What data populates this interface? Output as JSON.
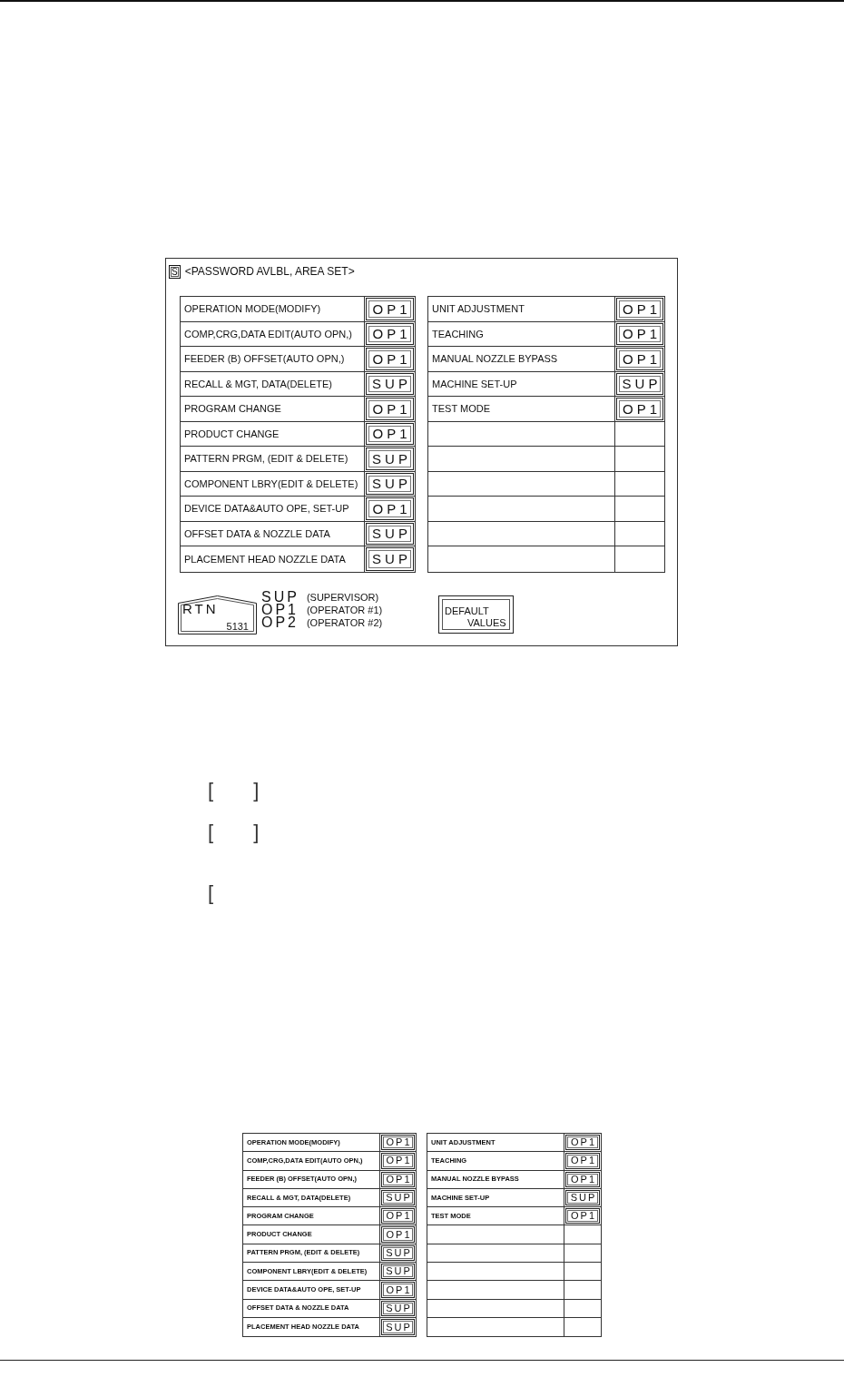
{
  "screen": {
    "tag": "S",
    "title": "<PASSWORD AVLBL, AREA SET>",
    "left_rows": [
      {
        "kind": "entry",
        "label": "OPERATION MODE(MODIFY)",
        "access": "OP1"
      },
      {
        "kind": "entry",
        "label": "COMP,CRG,DATA EDIT(AUTO OPN,)",
        "access": "OP1"
      },
      {
        "kind": "entry",
        "label": "FEEDER (B) OFFSET(AUTO OPN,)",
        "access": "OP1"
      },
      {
        "kind": "entry",
        "label": "RECALL & MGT, DATA(DELETE)",
        "access": "SUP"
      },
      {
        "kind": "entry",
        "label": "PROGRAM CHANGE",
        "access": "OP1"
      },
      {
        "kind": "entry",
        "label": "PRODUCT CHANGE",
        "access": "OP1"
      },
      {
        "kind": "entry",
        "label": "PATTERN PRGM, (EDIT & DELETE)",
        "access": "SUP"
      },
      {
        "kind": "entry",
        "label": "COMPONENT LBRY(EDIT & DELETE)",
        "access": "SUP"
      },
      {
        "kind": "entry",
        "label": "DEVICE DATA&AUTO OPE, SET-UP",
        "access": "OP1"
      },
      {
        "kind": "entry",
        "label": "OFFSET DATA & NOZZLE DATA",
        "access": "SUP"
      },
      {
        "kind": "entry",
        "label": "PLACEMENT HEAD NOZZLE DATA",
        "access": "SUP"
      }
    ],
    "right_rows": [
      {
        "kind": "entry",
        "label": "UNIT ADJUSTMENT",
        "access": "OP1"
      },
      {
        "kind": "entry",
        "label": "TEACHING",
        "access": "OP1"
      },
      {
        "kind": "entry",
        "label": "MANUAL NOZZLE BYPASS",
        "access": "OP1"
      },
      {
        "kind": "entry",
        "label": "MACHINE SET-UP",
        "access": "SUP"
      },
      {
        "kind": "entry",
        "label": "TEST MODE",
        "access": "OP1"
      },
      {
        "kind": "blank"
      },
      {
        "kind": "blank"
      },
      {
        "kind": "blank"
      },
      {
        "kind": "blank"
      },
      {
        "kind": "blank"
      },
      {
        "kind": "blank"
      }
    ],
    "return_button": {
      "label": "RTN",
      "code": "5131"
    },
    "legend": [
      {
        "code": "SUP",
        "meaning": "(SUPERVISOR)"
      },
      {
        "code": "OP1",
        "meaning": "(OPERATOR #1)"
      },
      {
        "code": "OP2",
        "meaning": "(OPERATOR #2)"
      }
    ],
    "default_button": {
      "lines": [
        "DEFAULT",
        "VALUES"
      ]
    }
  },
  "blanks": [
    {
      "open": "[",
      "close": "]"
    },
    {
      "open": "[",
      "close": "]"
    },
    {
      "open": "["
    }
  ],
  "figure_table": {
    "left_rows": [
      {
        "kind": "entry",
        "label": "OPERATION MODE(MODIFY)",
        "access": "OP1"
      },
      {
        "kind": "entry",
        "label": "COMP,CRG,DATA EDIT(AUTO OPN,)",
        "access": "OP1"
      },
      {
        "kind": "entry",
        "label": "FEEDER (B) OFFSET(AUTO OPN,)",
        "access": "OP1"
      },
      {
        "kind": "entry",
        "label": "RECALL & MGT, DATA(DELETE)",
        "access": "SUP"
      },
      {
        "kind": "entry",
        "label": "PROGRAM CHANGE",
        "access": "OP1"
      },
      {
        "kind": "entry",
        "label": "PRODUCT CHANGE",
        "access": "OP1"
      },
      {
        "kind": "entry",
        "label": "PATTERN PRGM, (EDIT & DELETE)",
        "access": "SUP"
      },
      {
        "kind": "entry",
        "label": "COMPONENT LBRY(EDIT & DELETE)",
        "access": "SUP"
      },
      {
        "kind": "entry",
        "label": "DEVICE DATA&AUTO OPE, SET-UP",
        "access": "OP1"
      },
      {
        "kind": "entry",
        "label": "OFFSET DATA & NOZZLE DATA",
        "access": "SUP"
      },
      {
        "kind": "entry",
        "label": "PLACEMENT HEAD NOZZLE DATA",
        "access": "SUP"
      }
    ],
    "right_rows": [
      {
        "kind": "entry",
        "label": "UNIT ADJUSTMENT",
        "access": "OP1"
      },
      {
        "kind": "entry",
        "label": "TEACHING",
        "access": "OP1"
      },
      {
        "kind": "entry",
        "label": "MANUAL NOZZLE BYPASS",
        "access": "OP1"
      },
      {
        "kind": "entry",
        "label": "MACHINE SET-UP",
        "access": "SUP"
      },
      {
        "kind": "entry",
        "label": "TEST MODE",
        "access": "OP1"
      },
      {
        "kind": "blank"
      },
      {
        "kind": "blank"
      },
      {
        "kind": "blank"
      },
      {
        "kind": "blank"
      },
      {
        "kind": "blank"
      },
      {
        "kind": "blank"
      }
    ]
  }
}
